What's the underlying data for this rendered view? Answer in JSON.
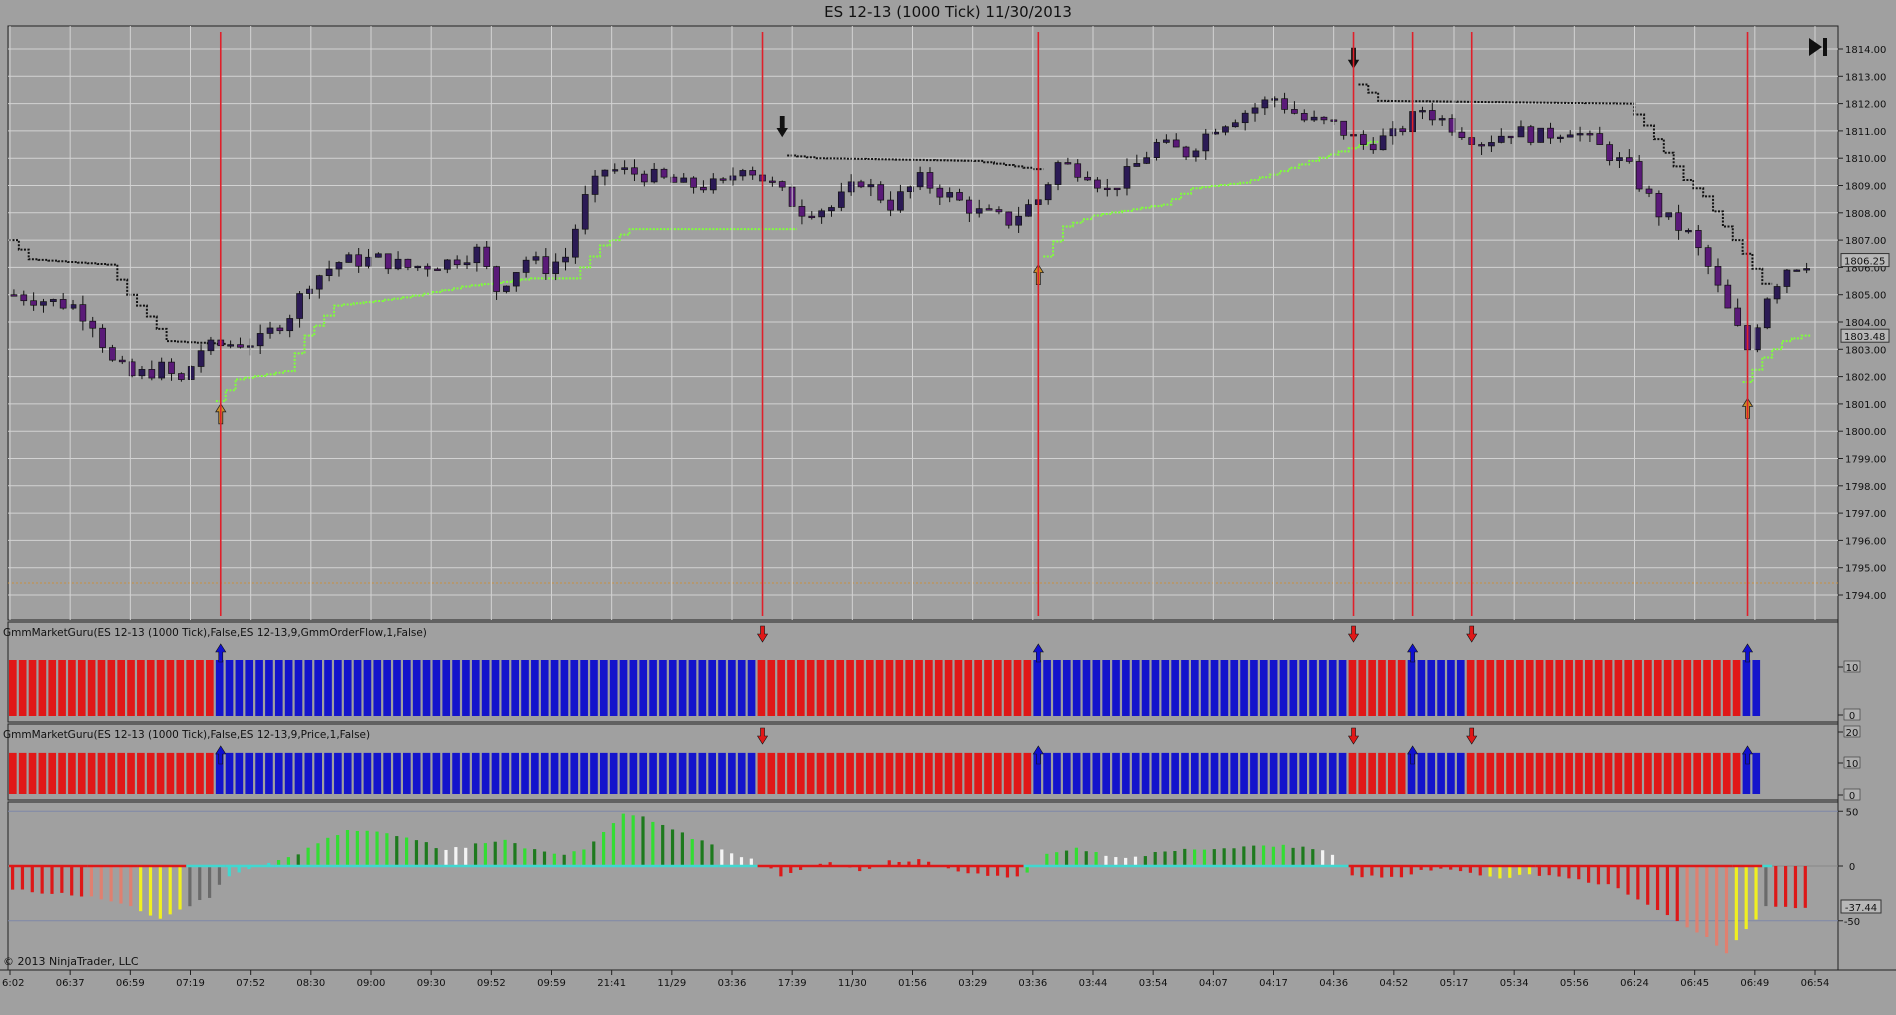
{
  "window": {
    "title": "ES 12-13 (1000 Tick)  11/30/2013"
  },
  "copyright": "© 2013 NinjaTrader, LLC",
  "icons": {
    "end_button": "skip-to-end-icon"
  },
  "colors": {
    "background": "#a0a0a0",
    "grid": "#d2d2d2",
    "candle_up": "#2b1a55",
    "candle_down": "#5a1a78",
    "stop_long": "#7fff3a",
    "stop_short": "#111111",
    "signal_line": "#e0202a",
    "bar_red": "#e01818",
    "bar_blue": "#1414cc",
    "osc_green": "#33dd33",
    "osc_darkgreen": "#1e7a1e",
    "osc_red": "#dd1818",
    "osc_yellow": "#f0f020",
    "osc_white": "#f4f4f4",
    "osc_gray": "#6a6a6a",
    "zero_line": "#40d8d0"
  },
  "chart_data": [
    {
      "type": "candlestick",
      "title": "ES 12-13 (1000 Tick)  11/30/2013",
      "x_tick_labels": [
        "6:02",
        "06:37",
        "06:59",
        "07:19",
        "07:52",
        "08:30",
        "09:00",
        "09:30",
        "09:52",
        "09:59",
        "21:41",
        "11/29",
        "03:36",
        "17:39",
        "11/30",
        "01:56",
        "03:29",
        "03:36",
        "03:44",
        "03:54",
        "04:07",
        "04:17",
        "04:36",
        "04:52",
        "05:17",
        "05:34",
        "05:56",
        "06:24",
        "06:45",
        "06:49",
        "06:54"
      ],
      "y_tick_labels": [
        "1814.00",
        "1813.00",
        "1812.00",
        "1811.00",
        "1810.00",
        "1809.00",
        "1808.00",
        "1807.00",
        "1806.00",
        "1805.00",
        "1804.00",
        "1803.00",
        "1802.00",
        "1801.00",
        "1800.00",
        "1799.00",
        "1798.00",
        "1797.00",
        "1796.00",
        "1795.00",
        "1794.00"
      ],
      "ylim": [
        1793.5,
        1814.5
      ],
      "price_markers": [
        "1806.25",
        "1803.48"
      ],
      "price_path": [
        [
          0,
          1805.0
        ],
        [
          6,
          1804.6
        ],
        [
          8,
          1804.0
        ],
        [
          10,
          1802.5
        ],
        [
          12,
          1802.0
        ],
        [
          15,
          1802.3
        ],
        [
          17,
          1801.8
        ],
        [
          19,
          1803.0
        ],
        [
          22,
          1803.2
        ],
        [
          25,
          1803.3
        ],
        [
          28,
          1804.3
        ],
        [
          30,
          1805.5
        ],
        [
          33,
          1806.2
        ],
        [
          37,
          1806.3
        ],
        [
          40,
          1806.0
        ],
        [
          44,
          1806.2
        ],
        [
          47,
          1806.6
        ],
        [
          49,
          1805.2
        ],
        [
          52,
          1806.3
        ],
        [
          54,
          1806.0
        ],
        [
          56,
          1806.4
        ],
        [
          58,
          1808.5
        ],
        [
          60,
          1809.6
        ],
        [
          64,
          1809.4
        ],
        [
          68,
          1809.0
        ],
        [
          72,
          1809.0
        ],
        [
          74,
          1809.8
        ],
        [
          77,
          1809.0
        ],
        [
          80,
          1808.1
        ],
        [
          83,
          1808.2
        ],
        [
          86,
          1809.2
        ],
        [
          89,
          1808.3
        ],
        [
          92,
          1809.2
        ],
        [
          95,
          1808.6
        ],
        [
          98,
          1808.0
        ],
        [
          101,
          1807.7
        ],
        [
          104,
          1808.5
        ],
        [
          106,
          1809.8
        ],
        [
          109,
          1809.5
        ],
        [
          111,
          1808.8
        ],
        [
          113,
          1809.4
        ],
        [
          116,
          1810.5
        ],
        [
          119,
          1810.2
        ],
        [
          122,
          1811.2
        ],
        [
          125,
          1811.7
        ],
        [
          128,
          1812.2
        ],
        [
          131,
          1811.4
        ],
        [
          134,
          1811.2
        ],
        [
          137,
          1810.5
        ],
        [
          140,
          1810.8
        ],
        [
          143,
          1811.8
        ],
        [
          146,
          1811.2
        ],
        [
          149,
          1810.6
        ],
        [
          152,
          1811.0
        ],
        [
          155,
          1810.8
        ],
        [
          158,
          1811.1
        ],
        [
          161,
          1810.4
        ],
        [
          164,
          1809.6
        ],
        [
          167,
          1808.0
        ],
        [
          170,
          1807.2
        ],
        [
          172,
          1806.0
        ],
        [
          174,
          1804.4
        ],
        [
          176,
          1803.0
        ],
        [
          178,
          1805.0
        ],
        [
          180,
          1806.0
        ],
        [
          182,
          1806.2
        ]
      ],
      "series": [
        {
          "name": "",
          "style": "stop_long",
          "points": [
            [
              21,
              1801.1
            ],
            [
              23,
              1801.9
            ],
            [
              28,
              1802.2
            ],
            [
              30,
              1803.5
            ],
            [
              33,
              1804.6
            ],
            [
              40,
              1804.9
            ],
            [
              46,
              1805.3
            ],
            [
              53,
              1805.6
            ],
            [
              57,
              1805.6
            ],
            [
              60,
              1806.8
            ],
            [
              63,
              1807.4
            ],
            [
              75,
              1807.4
            ],
            [
              79,
              1807.4
            ]
          ]
        },
        {
          "name": "",
          "style": "stop_long",
          "points": [
            [
              105,
              1806.4
            ],
            [
              107,
              1807.5
            ],
            [
              110,
              1807.9
            ],
            [
              117,
              1808.3
            ],
            [
              120,
              1808.9
            ],
            [
              125,
              1809.1
            ],
            [
              128,
              1809.4
            ],
            [
              132,
              1809.9
            ],
            [
              138,
              1810.6
            ]
          ]
        },
        {
          "name": "",
          "style": "stop_long",
          "points": [
            [
              176,
              1801.8
            ],
            [
              178,
              1802.7
            ],
            [
              180,
              1803.3
            ],
            [
              182,
              1803.5
            ]
          ]
        },
        {
          "name": "",
          "style": "stop_short",
          "points": [
            [
              0,
              1807.0
            ],
            [
              2,
              1806.3
            ],
            [
              10,
              1806.1
            ],
            [
              12,
              1805.0
            ],
            [
              14,
              1804.2
            ],
            [
              16,
              1803.3
            ],
            [
              21,
              1803.2
            ]
          ]
        },
        {
          "name": "",
          "style": "stop_short",
          "points": [
            [
              79,
              1810.1
            ],
            [
              82,
              1810.0
            ],
            [
              98,
              1809.9
            ],
            [
              104,
              1809.6
            ]
          ]
        },
        {
          "name": "",
          "style": "stop_short",
          "points": [
            [
              137,
              1812.7
            ],
            [
              139,
              1812.1
            ],
            [
              164,
              1812.0
            ],
            [
              166,
              1811.2
            ],
            [
              168,
              1810.2
            ],
            [
              170,
              1809.2
            ],
            [
              172,
              1808.6
            ],
            [
              174,
              1807.5
            ],
            [
              176,
              1806.5
            ],
            [
              178,
              1805.4
            ]
          ]
        }
      ],
      "signal_bars": [
        21,
        76,
        104,
        136,
        142,
        148,
        176
      ],
      "arrows": [
        {
          "bar": 21,
          "dir": "up",
          "price": 1800.6
        },
        {
          "bar": 104,
          "dir": "up",
          "price": 1805.7
        },
        {
          "bar": 176,
          "dir": "up",
          "price": 1800.8
        },
        {
          "bar": 78,
          "dir": "down",
          "price": 1811.2
        },
        {
          "bar": 136,
          "dir": "down",
          "price": 1813.7
        }
      ]
    },
    {
      "type": "bar",
      "title": "GmmMarketGuru(ES 12-13 (1000 Tick),False,ES 12-13,9,GmmOrderFlow,1,False)",
      "y_tick_labels": [
        "10",
        "0"
      ],
      "bar_count": 178,
      "segments": [
        {
          "from": 0,
          "to": 21,
          "color": "red"
        },
        {
          "from": 21,
          "to": 76,
          "color": "blue"
        },
        {
          "from": 76,
          "to": 104,
          "color": "red"
        },
        {
          "from": 104,
          "to": 136,
          "color": "blue"
        },
        {
          "from": 136,
          "to": 142,
          "color": "red"
        },
        {
          "from": 142,
          "to": 148,
          "color": "blue"
        },
        {
          "from": 148,
          "to": 176,
          "color": "red"
        },
        {
          "from": 176,
          "to": 179,
          "color": "blue"
        }
      ]
    },
    {
      "type": "bar",
      "title": "GmmMarketGuru(ES 12-13 (1000 Tick),False,ES 12-13,9,Price,1,False)",
      "y_tick_labels": [
        "20",
        "10",
        "0"
      ],
      "bar_count": 178,
      "segments": [
        {
          "from": 0,
          "to": 21,
          "color": "red"
        },
        {
          "from": 21,
          "to": 76,
          "color": "blue"
        },
        {
          "from": 76,
          "to": 104,
          "color": "red"
        },
        {
          "from": 104,
          "to": 136,
          "color": "blue"
        },
        {
          "from": 136,
          "to": 142,
          "color": "red"
        },
        {
          "from": 142,
          "to": 148,
          "color": "blue"
        },
        {
          "from": 148,
          "to": 176,
          "color": "red"
        },
        {
          "from": 176,
          "to": 179,
          "color": "blue"
        }
      ]
    },
    {
      "type": "bar",
      "title": "",
      "y_tick_labels": [
        "50",
        "0",
        "-50"
      ],
      "last_value": "-37.44",
      "ylim": [
        -85,
        55
      ],
      "shape": [
        [
          0,
          -22
        ],
        [
          3,
          -24
        ],
        [
          6,
          -26
        ],
        [
          9,
          -30
        ],
        [
          12,
          -38
        ],
        [
          15,
          -48
        ],
        [
          17,
          -40
        ],
        [
          20,
          -28
        ],
        [
          22,
          -8
        ],
        [
          25,
          0
        ],
        [
          27,
          5
        ],
        [
          29,
          12
        ],
        [
          31,
          22
        ],
        [
          34,
          32
        ],
        [
          38,
          30
        ],
        [
          41,
          24
        ],
        [
          44,
          14
        ],
        [
          47,
          20
        ],
        [
          50,
          24
        ],
        [
          53,
          14
        ],
        [
          56,
          10
        ],
        [
          58,
          14
        ],
        [
          60,
          30
        ],
        [
          62,
          48
        ],
        [
          64,
          44
        ],
        [
          67,
          34
        ],
        [
          70,
          22
        ],
        [
          73,
          12
        ],
        [
          76,
          2
        ],
        [
          78,
          -8
        ],
        [
          80,
          -4
        ],
        [
          83,
          4
        ],
        [
          86,
          -4
        ],
        [
          89,
          4
        ],
        [
          92,
          6
        ],
        [
          95,
          -3
        ],
        [
          98,
          -8
        ],
        [
          101,
          -10
        ],
        [
          103,
          -7
        ],
        [
          105,
          10
        ],
        [
          108,
          16
        ],
        [
          111,
          10
        ],
        [
          114,
          8
        ],
        [
          117,
          14
        ],
        [
          120,
          16
        ],
        [
          123,
          17
        ],
        [
          126,
          18
        ],
        [
          129,
          18
        ],
        [
          132,
          16
        ],
        [
          134,
          10
        ],
        [
          136,
          -8
        ],
        [
          138,
          -10
        ],
        [
          141,
          -9
        ],
        [
          143,
          -4
        ],
        [
          145,
          -2
        ],
        [
          148,
          -6
        ],
        [
          151,
          -12
        ],
        [
          154,
          -8
        ],
        [
          157,
          -10
        ],
        [
          160,
          -14
        ],
        [
          163,
          -20
        ],
        [
          166,
          -34
        ],
        [
          169,
          -50
        ],
        [
          172,
          -66
        ],
        [
          174,
          -80
        ],
        [
          176,
          -58
        ],
        [
          178,
          -38
        ]
      ],
      "colour_runs": [
        [
          0,
          8,
          "red"
        ],
        [
          8,
          13,
          "salmon"
        ],
        [
          13,
          18,
          "yellow"
        ],
        [
          18,
          22,
          "gray"
        ],
        [
          22,
          27,
          "cyan"
        ],
        [
          27,
          40,
          "green"
        ],
        [
          40,
          44,
          "darkgreen"
        ],
        [
          44,
          47,
          "white"
        ],
        [
          47,
          53,
          "green"
        ],
        [
          53,
          58,
          "darkgreen"
        ],
        [
          58,
          66,
          "green"
        ],
        [
          66,
          72,
          "darkgreen"
        ],
        [
          72,
          76,
          "white"
        ],
        [
          76,
          103,
          "red"
        ],
        [
          103,
          111,
          "green"
        ],
        [
          111,
          115,
          "white"
        ],
        [
          115,
          133,
          "darkgreen"
        ],
        [
          133,
          136,
          "white"
        ],
        [
          136,
          150,
          "red"
        ],
        [
          150,
          155,
          "yellow"
        ],
        [
          155,
          170,
          "red"
        ],
        [
          170,
          175,
          "salmon"
        ],
        [
          175,
          178,
          "yellow"
        ],
        [
          178,
          179,
          "gray"
        ]
      ]
    }
  ]
}
